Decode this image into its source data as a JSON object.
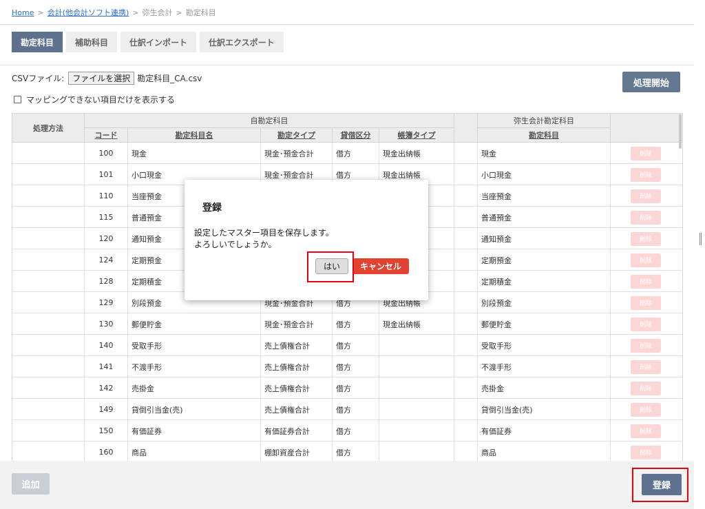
{
  "breadcrumb": {
    "home": "Home",
    "accounting": "会計(他会計ソフト連携)",
    "yayoi": "弥生会計",
    "current": "勘定科目",
    "sep": ">"
  },
  "tabs": [
    {
      "label": "勘定科目",
      "active": true
    },
    {
      "label": "補助科目",
      "active": false
    },
    {
      "label": "仕訳インポート",
      "active": false
    },
    {
      "label": "仕訳エクスポート",
      "active": false
    }
  ],
  "csv": {
    "label": "CSVファイル:",
    "file_button": "ファイルを選択",
    "file_name": "勘定科目_CA.csv"
  },
  "start_button": "処理開始",
  "filter_label": "マッピングできない項目だけを表示する",
  "table": {
    "header_method": "処理方法",
    "group_own": "自勘定科目",
    "group_yayoi": "弥生会計勘定科目",
    "col_code": "コード",
    "col_name": "勘定科目名",
    "col_type": "勘定タイプ",
    "col_side": "貸借区分",
    "col_book": "帳簿タイプ",
    "col_yayoi": "勘定科目",
    "delete_label": "削除",
    "rows": [
      {
        "code": "100",
        "name": "現金",
        "type": "現金･預金合計",
        "side": "借方",
        "book": "現金出納帳",
        "yayoi": "現金"
      },
      {
        "code": "101",
        "name": "小口現金",
        "type": "現金･預金合計",
        "side": "借方",
        "book": "現金出納帳",
        "yayoi": "小口現金"
      },
      {
        "code": "110",
        "name": "当座預金",
        "type": "",
        "side": "",
        "book": "",
        "yayoi": "当座預金"
      },
      {
        "code": "115",
        "name": "普通預金",
        "type": "",
        "side": "",
        "book": "",
        "yayoi": "普通預金"
      },
      {
        "code": "120",
        "name": "通知預金",
        "type": "",
        "side": "",
        "book": "",
        "yayoi": "通知預金"
      },
      {
        "code": "124",
        "name": "定期預金",
        "type": "",
        "side": "",
        "book": "",
        "yayoi": "定期預金"
      },
      {
        "code": "128",
        "name": "定期積金",
        "type": "",
        "side": "",
        "book": "",
        "yayoi": "定期積金"
      },
      {
        "code": "129",
        "name": "別段預金",
        "type": "現金･預金合計",
        "side": "借方",
        "book": "現金出納帳",
        "yayoi": "別段預金"
      },
      {
        "code": "130",
        "name": "郵便貯金",
        "type": "現金･預金合計",
        "side": "借方",
        "book": "現金出納帳",
        "yayoi": "郵便貯金"
      },
      {
        "code": "140",
        "name": "受取手形",
        "type": "売上債権合計",
        "side": "借方",
        "book": "",
        "yayoi": "受取手形"
      },
      {
        "code": "141",
        "name": "不渡手形",
        "type": "売上債権合計",
        "side": "借方",
        "book": "",
        "yayoi": "不渡手形"
      },
      {
        "code": "142",
        "name": "売掛金",
        "type": "売上債権合計",
        "side": "借方",
        "book": "",
        "yayoi": "売掛金"
      },
      {
        "code": "149",
        "name": "貸倒引当金(売)",
        "type": "売上債権合計",
        "side": "借方",
        "book": "",
        "yayoi": "貸倒引当金(売)"
      },
      {
        "code": "150",
        "name": "有価証券",
        "type": "有価証券合計",
        "side": "借方",
        "book": "",
        "yayoi": "有価証券"
      },
      {
        "code": "160",
        "name": "商品",
        "type": "棚卸資産合計",
        "side": "借方",
        "book": "",
        "yayoi": "商品"
      }
    ]
  },
  "footer": {
    "add_button": "追加",
    "register_button": "登録"
  },
  "dialog": {
    "title": "登録",
    "message_line1": "設定したマスター項目を保存します。",
    "message_line2": "よろしいでしょうか。",
    "yes_button": "はい",
    "cancel_button": "キャンセル"
  }
}
